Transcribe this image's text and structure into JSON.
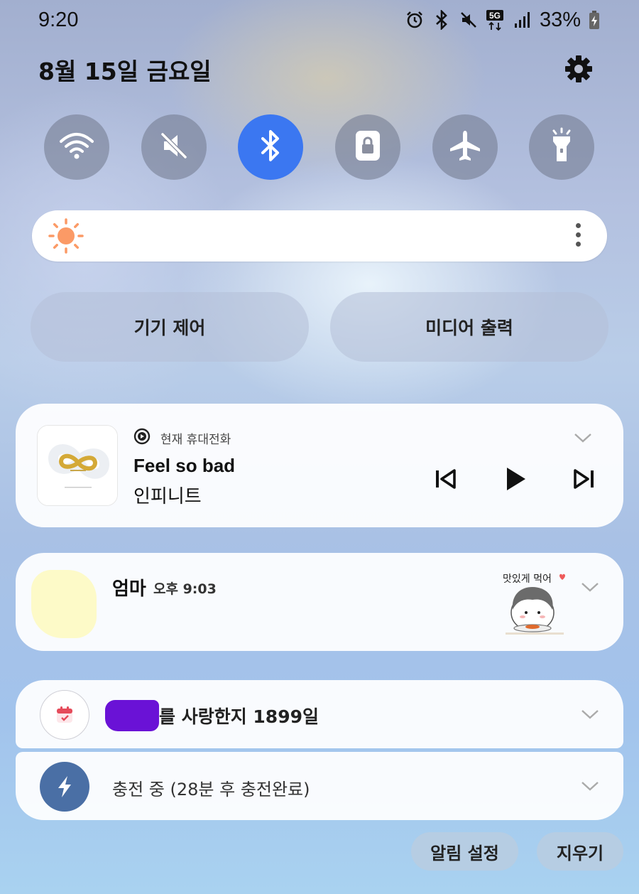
{
  "status_bar": {
    "time": "9:20",
    "network": "5G",
    "battery": "33%",
    "icons": [
      "alarm-icon",
      "bluetooth-icon",
      "mute-icon",
      "5g-data-icon",
      "signal-icon",
      "battery-charging-icon"
    ]
  },
  "header": {
    "date": "8월 15일 금요일",
    "settings_icon": "gear-icon"
  },
  "quick_settings": [
    {
      "name": "wifi",
      "icon": "wifi-icon",
      "active": false
    },
    {
      "name": "sound",
      "icon": "mute-icon",
      "active": false
    },
    {
      "name": "bluetooth",
      "icon": "bluetooth-icon",
      "active": true
    },
    {
      "name": "rotation-lock",
      "icon": "lock-icon",
      "active": false
    },
    {
      "name": "airplane",
      "icon": "airplane-icon",
      "active": false
    },
    {
      "name": "flashlight",
      "icon": "flashlight-icon",
      "active": false
    }
  ],
  "brightness": {
    "icon": "sun-icon",
    "more_icon": "more-vertical-icon"
  },
  "pills": {
    "device_control": "기기 제어",
    "media_output": "미디어 출력"
  },
  "media": {
    "source": "현재 휴대전화",
    "title": "Feel so bad",
    "artist": "인피니트",
    "controls": [
      "previous-icon",
      "play-icon",
      "next-icon"
    ]
  },
  "message": {
    "sender": "엄마",
    "time": "오후 9:03",
    "sticker_text": "맛있게 먹어"
  },
  "anniversary": {
    "text": "를 사랑한지 1899일"
  },
  "charging": {
    "text": "충전 중 (28분 후 충전완료)"
  },
  "footer": {
    "notification_settings": "알림 설정",
    "clear": "지우기"
  },
  "colors": {
    "accent_blue": "#3b77f1",
    "sun_orange": "#fb9a66",
    "charge_blue": "#4a6fa5",
    "redaction_purple": "#6a12d6",
    "calendar_red": "#e54b5a"
  }
}
